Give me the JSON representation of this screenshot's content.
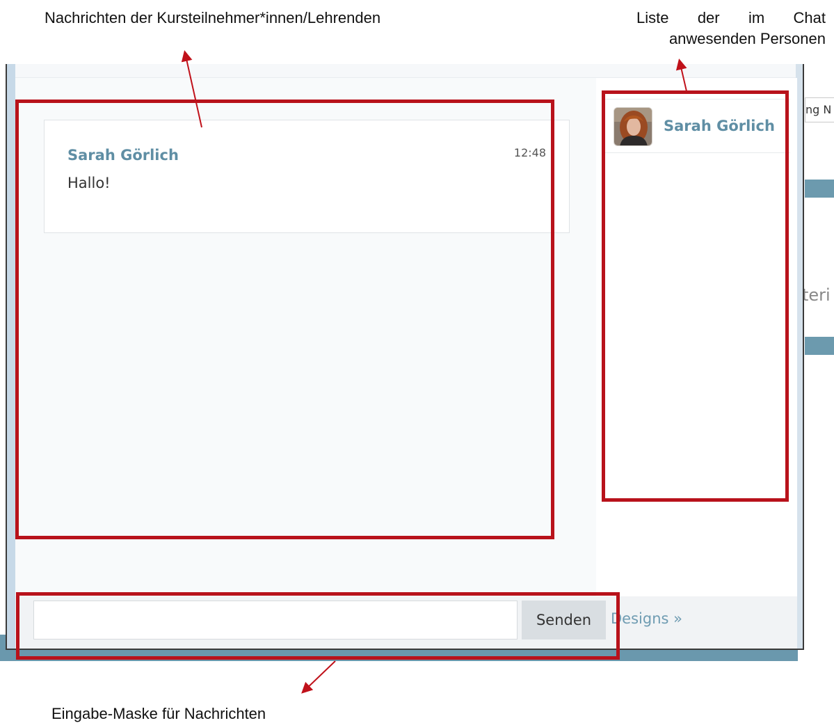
{
  "annotations": {
    "messages_label": "Nachrichten der Kursteilnehmer*innen/Lehrenden",
    "users_label_line1": "Liste der im Chat",
    "users_label_line2": "anwesenden Personen",
    "input_label": "Eingabe-Maske für Nachrichten"
  },
  "chat": {
    "messages": [
      {
        "author": "Sarah Görlich",
        "time": "12:48",
        "text": "Hallo!"
      }
    ],
    "users": [
      {
        "name": "Sarah Görlich"
      }
    ],
    "input": {
      "value": "",
      "placeholder": ""
    },
    "send_label": "Senden",
    "designs_link": "Designs »"
  },
  "background_app": {
    "input_fragment": "ng N",
    "text_fragment": "teri"
  },
  "colors": {
    "annotation_red": "#b8121b",
    "author_blue": "#5f8ea4",
    "bar_blue": "#6a98ad"
  }
}
